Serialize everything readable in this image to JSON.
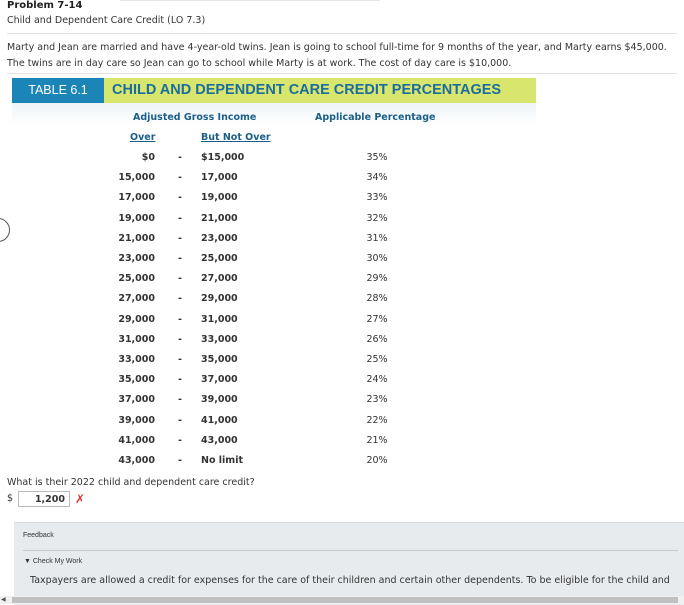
{
  "problem": {
    "title": "Problem 7-14",
    "subtitle": "Child and Dependent Care Credit (LO 7.3)",
    "description": "Marty and Jean are married and have 4-year-old twins. Jean is going to school full-time for 9 months of the year, and Marty earns $45,000. The twins are in day care so Jean can go to school while Marty is at work. The cost of day care is $10,000."
  },
  "table": {
    "tag": "TABLE 6.1",
    "title": "CHILD AND DEPENDENT CARE CREDIT PERCENTAGES",
    "col_agi": "Adjusted Gross Income",
    "col_pct": "Applicable Percentage",
    "sub_over": "Over",
    "sub_notover": "But Not Over",
    "dash": "-",
    "rows": [
      {
        "over": "$0",
        "not_over": "$15,000",
        "pct": "35%"
      },
      {
        "over": "15,000",
        "not_over": "17,000",
        "pct": "34%"
      },
      {
        "over": "17,000",
        "not_over": "19,000",
        "pct": "33%"
      },
      {
        "over": "19,000",
        "not_over": "21,000",
        "pct": "32%"
      },
      {
        "over": "21,000",
        "not_over": "23,000",
        "pct": "31%"
      },
      {
        "over": "23,000",
        "not_over": "25,000",
        "pct": "30%"
      },
      {
        "over": "25,000",
        "not_over": "27,000",
        "pct": "29%"
      },
      {
        "over": "27,000",
        "not_over": "29,000",
        "pct": "28%"
      },
      {
        "over": "29,000",
        "not_over": "31,000",
        "pct": "27%"
      },
      {
        "over": "31,000",
        "not_over": "33,000",
        "pct": "26%"
      },
      {
        "over": "33,000",
        "not_over": "35,000",
        "pct": "25%"
      },
      {
        "over": "35,000",
        "not_over": "37,000",
        "pct": "24%"
      },
      {
        "over": "37,000",
        "not_over": "39,000",
        "pct": "23%"
      },
      {
        "over": "39,000",
        "not_over": "41,000",
        "pct": "22%"
      },
      {
        "over": "41,000",
        "not_over": "43,000",
        "pct": "21%"
      },
      {
        "over": "43,000",
        "not_over": "No limit",
        "pct": "20%"
      }
    ]
  },
  "question": {
    "text": "What is their 2022 child and dependent care credit?",
    "currency": "$",
    "answer": "1,200",
    "status_mark": "✗"
  },
  "feedback": {
    "label": "Feedback",
    "check_label": "▼ Check My Work",
    "text": "Taxpayers are allowed a credit for expenses for the care of their children and certain other dependents. To be eligible for the child and"
  },
  "scrollbar": {
    "arrow": "◀"
  },
  "colors": {
    "tag_bg": "#1c85b8",
    "header_bg": "#d9e66d",
    "title_color": "#1a6d9d",
    "error_red": "#e23232"
  }
}
